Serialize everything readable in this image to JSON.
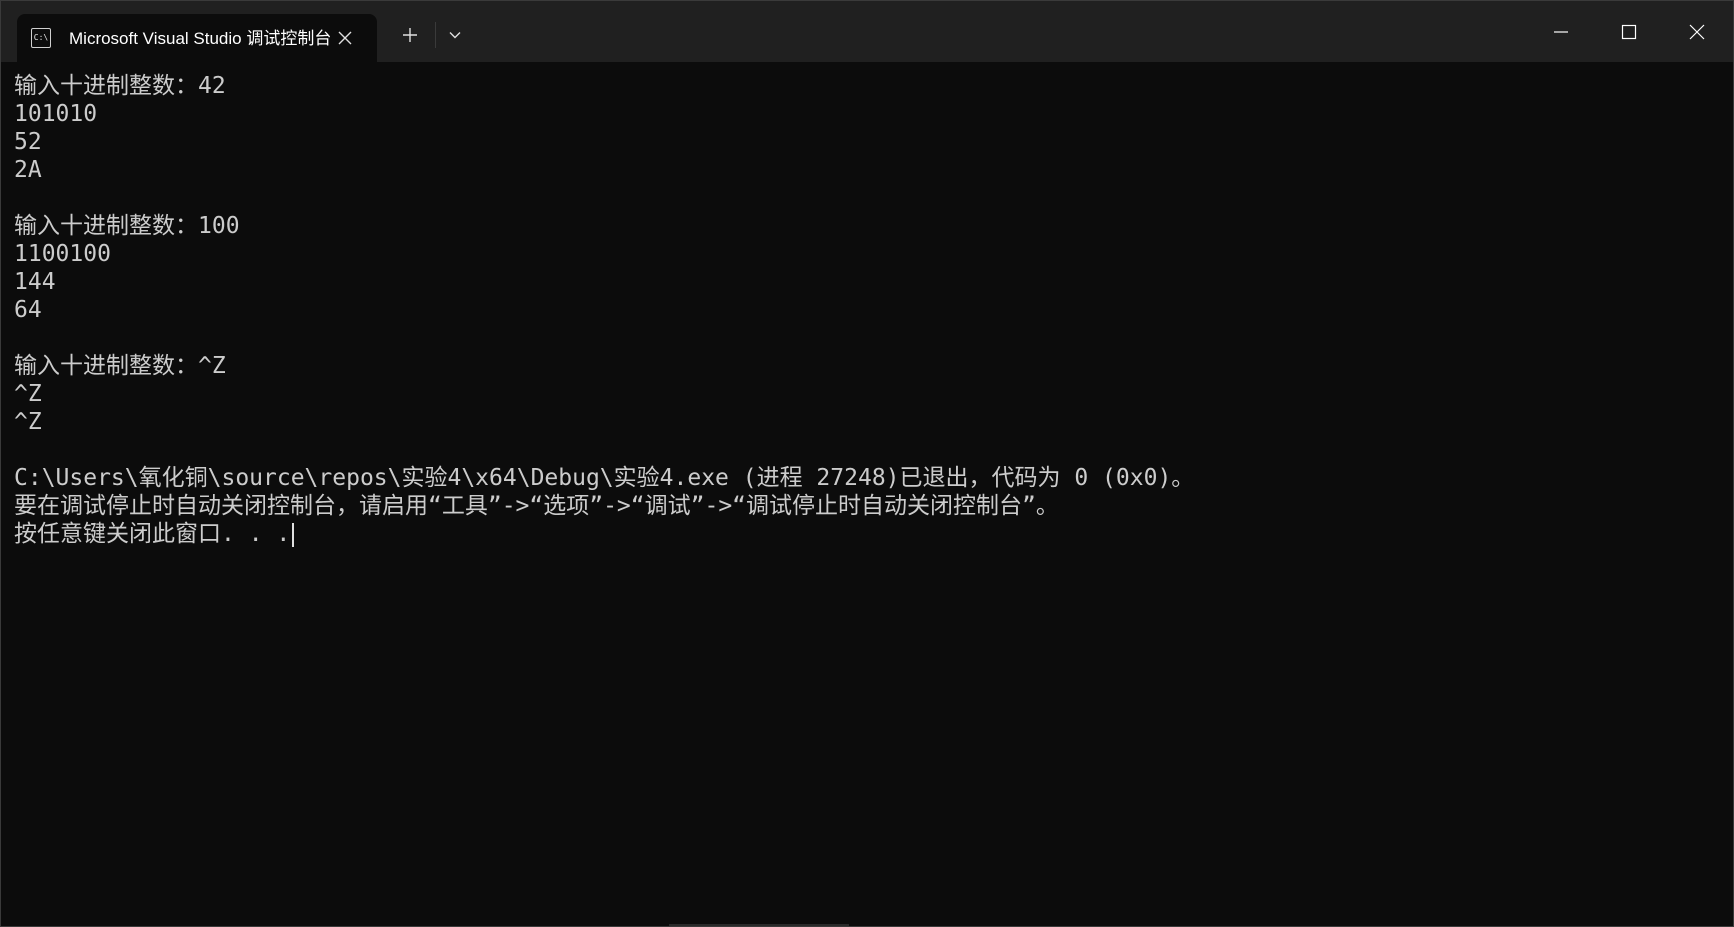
{
  "tab": {
    "icon_glyph": "C:\\",
    "title": "Microsoft Visual Studio 调试控制台"
  },
  "titlebar_icons": {
    "tab_close": "close-icon",
    "new_tab": "plus-icon",
    "dropdown": "chevron-down-icon",
    "minimize": "minimize-icon",
    "maximize": "maximize-icon",
    "close": "close-icon"
  },
  "colors": {
    "console_bg": "#0c0c0c",
    "titlebar_bg": "#202020",
    "text": "#cccccc"
  },
  "console": {
    "lines": [
      "输入十进制整数：42",
      "101010",
      "52",
      "2A",
      "",
      "输入十进制整数：100",
      "1100100",
      "144",
      "64",
      "",
      "输入十进制整数：^Z",
      "^Z",
      "^Z",
      "",
      "C:\\Users\\氧化铜\\source\\repos\\实验4\\x64\\Debug\\实验4.exe (进程 27248)已退出，代码为 0 (0x0)。",
      "要在调试停止时自动关闭控制台，请启用“工具”->“选项”->“调试”->“调试停止时自动关闭控制台”。",
      "按任意键关闭此窗口. . ."
    ]
  }
}
